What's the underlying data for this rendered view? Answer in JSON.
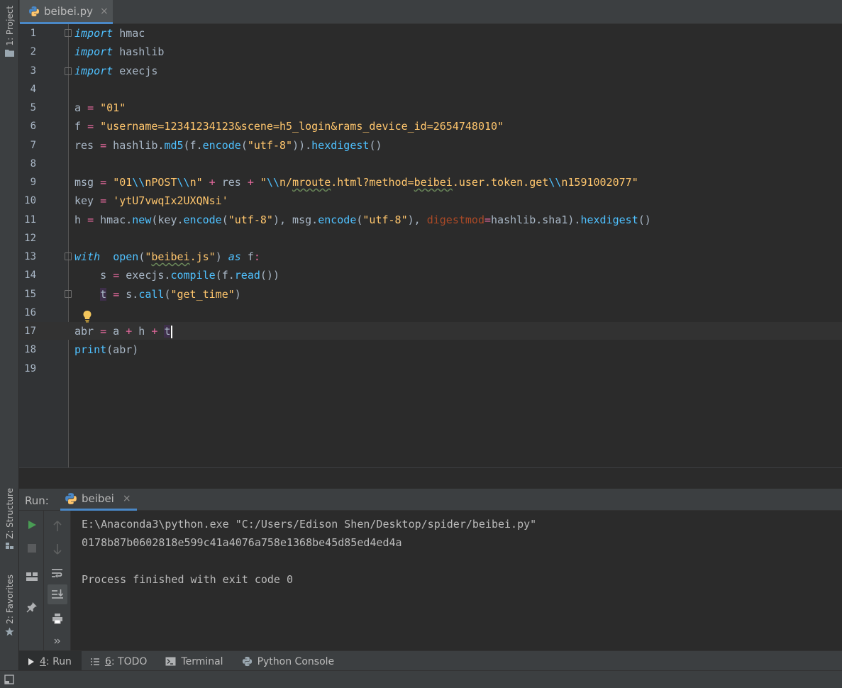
{
  "left_strip": {
    "project_label": "1: Project",
    "structure_label": "Z: Structure",
    "favorites_label": "2: Favorites"
  },
  "editor_tab": {
    "label": "beibei.py",
    "close": "×"
  },
  "editor": {
    "line_numbers": [
      "1",
      "2",
      "3",
      "4",
      "5",
      "6",
      "7",
      "8",
      "9",
      "10",
      "11",
      "12",
      "13",
      "14",
      "15",
      "16",
      "17",
      "18",
      "19"
    ]
  },
  "run_panel": {
    "title": "Run:",
    "tab_label": "beibei",
    "tab_close": "×",
    "console_lines": [
      "E:\\Anaconda3\\python.exe \"C:/Users/Edison Shen/Desktop/spider/beibei.py\"",
      "0178b87b0602818e599c41a4076a758e1368be45d85ed4ed4a",
      "",
      "Process finished with exit code 0"
    ]
  },
  "bottom_bar": {
    "run": {
      "num": "4",
      "label": ": Run"
    },
    "todo": {
      "num": "6",
      "label": ": TODO"
    },
    "terminal": "Terminal",
    "python_console": "Python Console"
  }
}
